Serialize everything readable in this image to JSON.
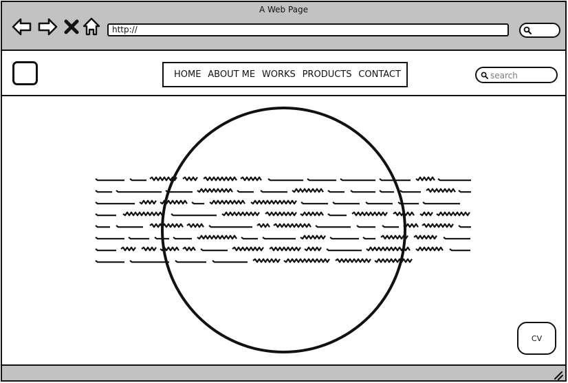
{
  "window": {
    "title": "A Web Page"
  },
  "browser": {
    "url": "http://",
    "icons": {
      "back": "arrow-left-icon",
      "forward": "arrow-right-icon",
      "stop": "close-icon",
      "home": "home-icon",
      "search": "search-icon"
    }
  },
  "header": {
    "menu": [
      "HOME",
      "ABOUT ME",
      "WORKS",
      "PRODUCTS",
      "CONTACT"
    ],
    "search": {
      "placeholder": "search",
      "value": ""
    }
  },
  "content": {
    "cv_label": "CV"
  },
  "colors": {
    "chrome": "#c2c2c2",
    "stroke": "#111111",
    "background": "#ffffff"
  }
}
